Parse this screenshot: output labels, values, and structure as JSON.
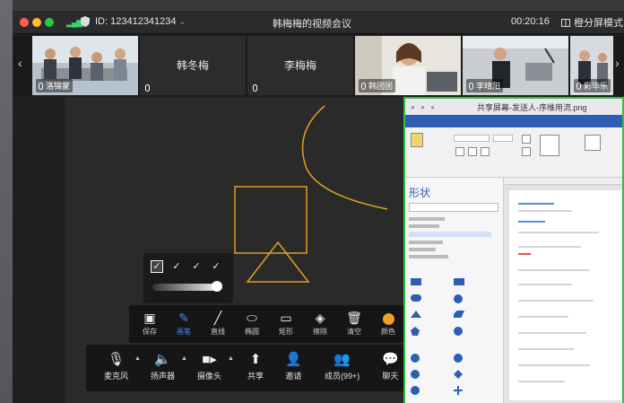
{
  "titlebar": {
    "meeting_id": "ID: 123412341234",
    "title": "韩梅梅的视频会议",
    "timer": "00:20:16",
    "layout_label": "橙分屏模式"
  },
  "participants": [
    {
      "name": "洛锦蒙",
      "video": true
    },
    {
      "name": "韩冬梅",
      "video": false
    },
    {
      "name": "李梅梅",
      "video": false
    },
    {
      "name": "韩团团",
      "video": true
    },
    {
      "name": "李晴阳",
      "video": true
    },
    {
      "name": "彩毕乐",
      "video": true
    }
  ],
  "annotation_toolbar": [
    {
      "label": "保存",
      "icon": "save-icon"
    },
    {
      "label": "画笔",
      "icon": "pen-icon",
      "active": true
    },
    {
      "label": "直线",
      "icon": "line-icon"
    },
    {
      "label": "椭圆",
      "icon": "ellipse-icon"
    },
    {
      "label": "矩形",
      "icon": "rectangle-icon"
    },
    {
      "label": "擦除",
      "icon": "eraser-icon"
    },
    {
      "label": "清空",
      "icon": "trash-icon"
    },
    {
      "label": "颜色",
      "icon": "color-icon"
    }
  ],
  "controls": [
    {
      "label": "麦克风",
      "icon": "microphone-icon"
    },
    {
      "label": "扬声器",
      "icon": "speaker-icon"
    },
    {
      "label": "摄像头",
      "icon": "camera-icon"
    },
    {
      "label": "共享",
      "icon": "share-icon"
    },
    {
      "label": "邀请",
      "icon": "invite-icon"
    },
    {
      "label": "成员(99+)",
      "icon": "members-icon"
    },
    {
      "label": "聊天",
      "icon": "chat-icon"
    }
  ],
  "shared_window": {
    "title": "共享屏幕-发送人-序维用流.png",
    "shapes_panel_title": "形状"
  },
  "colors": {
    "accent": "#3a8ef6",
    "share_border": "#30c040",
    "drawing": "#e0a020"
  }
}
